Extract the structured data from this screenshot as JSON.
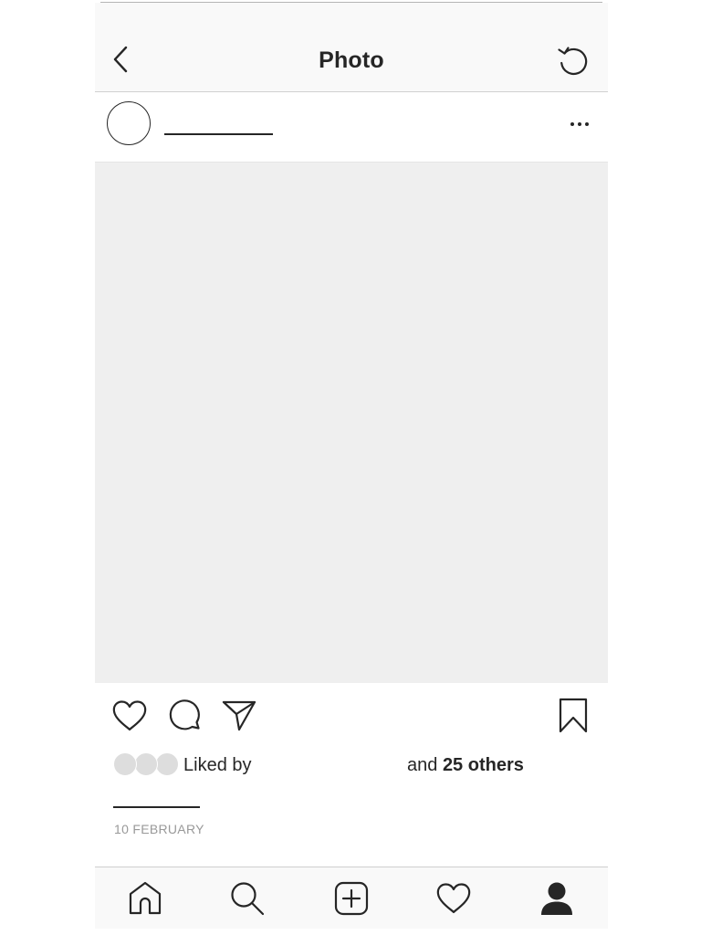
{
  "nav": {
    "title": "Photo",
    "back_icon": "chevron-left-icon",
    "refresh_icon": "refresh-icon"
  },
  "post": {
    "username": "",
    "more_icon": "ellipsis-icon",
    "actions": [
      "heart-icon",
      "comment-icon",
      "share-icon",
      "bookmark-icon"
    ],
    "likes": {
      "liked_by_label": "Liked by",
      "liked_by_name": "",
      "and_label": "and",
      "others_label": "25 others"
    },
    "caption": "",
    "date": "10 FEBRUARY"
  },
  "tab_bar": {
    "items": [
      "home-icon",
      "search-icon",
      "add-post-icon",
      "activity-heart-icon",
      "profile-icon"
    ]
  },
  "colors": {
    "text": "#262626",
    "bar_background": "#f9f9f9",
    "photo_placeholder": "#efefef",
    "muted": "#999999"
  }
}
